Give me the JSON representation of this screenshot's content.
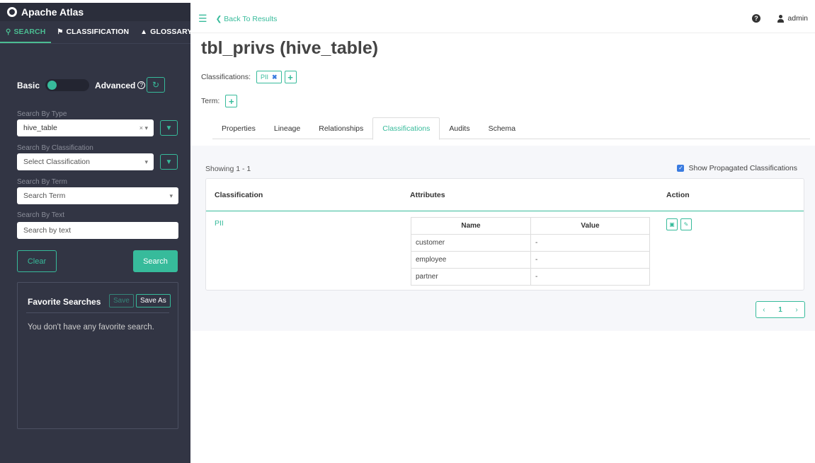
{
  "app": {
    "title": "Apache Atlas"
  },
  "sidebar": {
    "tabs": [
      {
        "label": "SEARCH",
        "icon": "search-icon"
      },
      {
        "label": "CLASSIFICATION",
        "icon": "tag-icon"
      },
      {
        "label": "GLOSSARY",
        "icon": "folder-icon"
      }
    ],
    "mode": {
      "basic": "Basic",
      "advanced": "Advanced"
    },
    "search_by_type": {
      "label": "Search By Type",
      "value": "hive_table"
    },
    "search_by_classification": {
      "label": "Search By Classification",
      "placeholder": "Select Classification"
    },
    "search_by_term": {
      "label": "Search By Term",
      "placeholder": "Search Term"
    },
    "search_by_text": {
      "label": "Search By Text",
      "placeholder": "Search by text"
    },
    "clear_label": "Clear",
    "search_label": "Search",
    "favorites": {
      "title": "Favorite Searches",
      "save_label": "Save",
      "save_as_label": "Save As",
      "empty_text": "You don't have any favorite search."
    }
  },
  "topbar": {
    "back_label": "Back To Results",
    "user": "admin"
  },
  "entity": {
    "title": "tbl_privs (hive_table)",
    "classifications_label": "Classifications:",
    "classification_tag": "PII",
    "term_label": "Term:"
  },
  "tabs": [
    "Properties",
    "Lineage",
    "Relationships",
    "Classifications",
    "Audits",
    "Schema"
  ],
  "active_tab": "Classifications",
  "classifications_panel": {
    "showing": "Showing 1 - 1",
    "show_propagated": "Show Propagated Classifications",
    "headers": {
      "classification": "Classification",
      "attributes": "Attributes",
      "action": "Action"
    },
    "row": {
      "name": "PII",
      "attr_headers": {
        "name": "Name",
        "value": "Value"
      },
      "attributes": [
        {
          "name": "customer",
          "value": "-"
        },
        {
          "name": "employee",
          "value": "-"
        },
        {
          "name": "partner",
          "value": "-"
        }
      ]
    },
    "pagination": {
      "page": "1"
    }
  },
  "colors": {
    "accent": "#37bb9b",
    "sidebar_bg": "#323544",
    "link_blue": "#3a7be0"
  }
}
